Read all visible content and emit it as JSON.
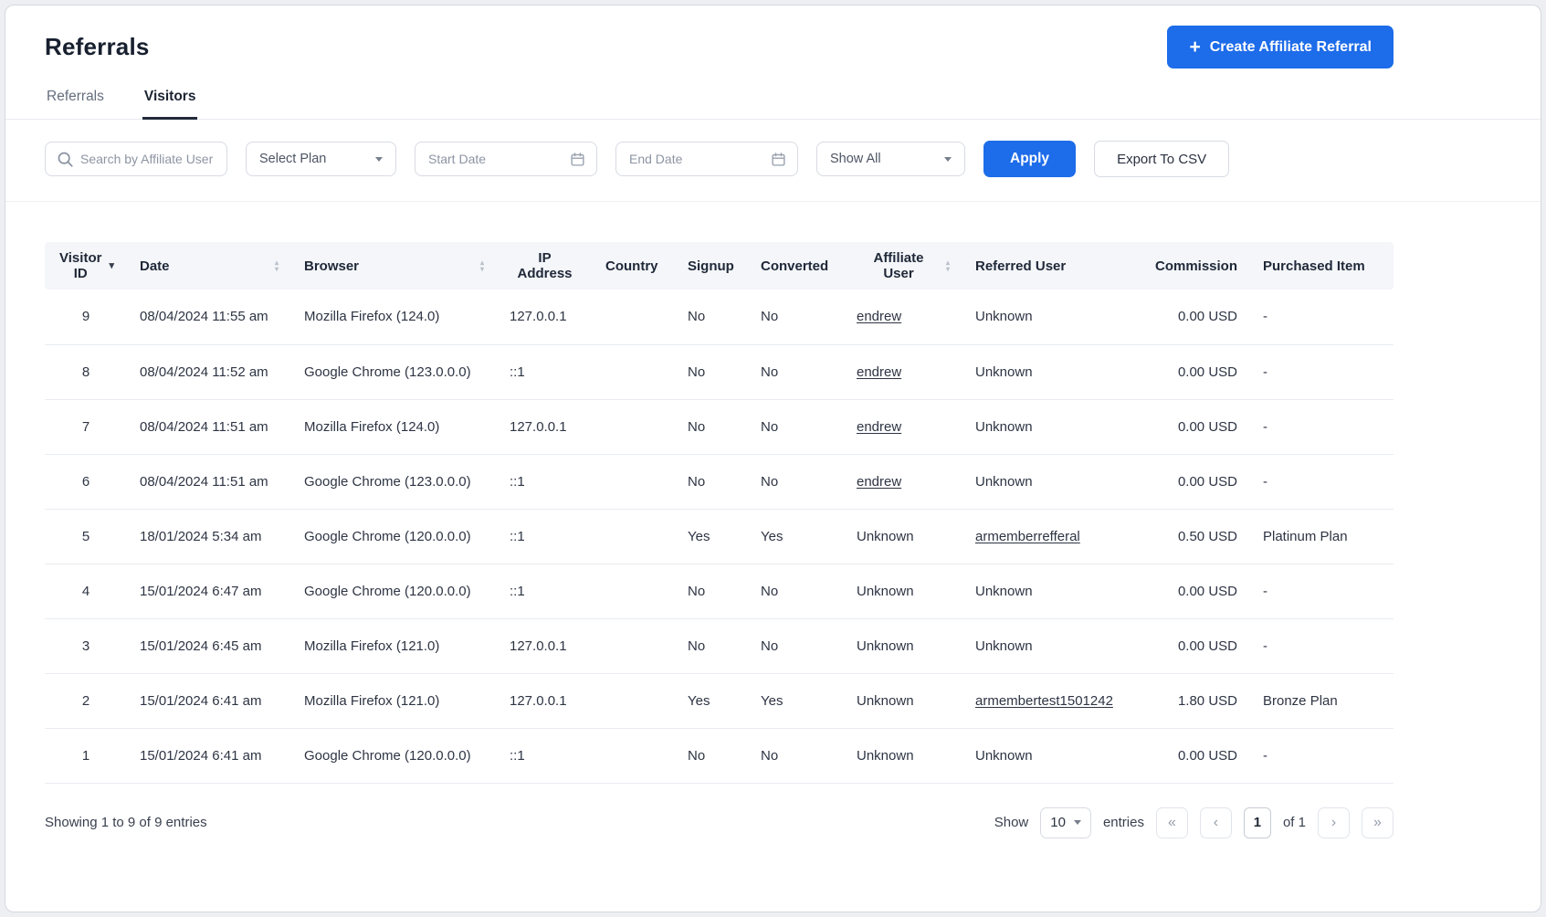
{
  "colors": {
    "accent": "#1d6ce9"
  },
  "page": {
    "title": "Referrals",
    "create_button_label": "Create Affiliate Referral"
  },
  "tabs": [
    {
      "label": "Referrals",
      "active": false
    },
    {
      "label": "Visitors",
      "active": true
    }
  ],
  "filters": {
    "search_placeholder": "Search by Affiliate User",
    "plan_select_value": "Select Plan",
    "start_date_placeholder": "Start Date",
    "end_date_placeholder": "End Date",
    "status_select_value": "Show All",
    "apply_label": "Apply",
    "export_label": "Export To CSV"
  },
  "table": {
    "columns": [
      {
        "key": "id",
        "label": "Visitor ID",
        "sort": "desc",
        "align": "center"
      },
      {
        "key": "date",
        "label": "Date",
        "sort": "both",
        "align": "left"
      },
      {
        "key": "browser",
        "label": "Browser",
        "sort": "both",
        "align": "left"
      },
      {
        "key": "ip",
        "label": "IP Address",
        "sort": null,
        "align": "left"
      },
      {
        "key": "country",
        "label": "Country",
        "sort": null,
        "align": "left"
      },
      {
        "key": "signup",
        "label": "Signup",
        "sort": null,
        "align": "left"
      },
      {
        "key": "converted",
        "label": "Converted",
        "sort": null,
        "align": "left"
      },
      {
        "key": "affiliate",
        "label": "Affiliate User",
        "sort": "both",
        "align": "left"
      },
      {
        "key": "referred",
        "label": "Referred User",
        "sort": null,
        "align": "left"
      },
      {
        "key": "commission",
        "label": "Commission",
        "sort": null,
        "align": "right"
      },
      {
        "key": "item",
        "label": "Purchased Item",
        "sort": null,
        "align": "left"
      }
    ],
    "rows": [
      {
        "id": "9",
        "date": "08/04/2024 11:55 am",
        "browser": "Mozilla Firefox (124.0)",
        "ip": "127.0.0.1",
        "country": "",
        "signup": "No",
        "converted": "No",
        "affiliate": "endrew",
        "affiliate_is_link": true,
        "referred": "Unknown",
        "referred_is_link": false,
        "commission": "0.00 USD",
        "item": "-"
      },
      {
        "id": "8",
        "date": "08/04/2024 11:52 am",
        "browser": "Google Chrome (123.0.0.0)",
        "ip": "::1",
        "country": "",
        "signup": "No",
        "converted": "No",
        "affiliate": "endrew",
        "affiliate_is_link": true,
        "referred": "Unknown",
        "referred_is_link": false,
        "commission": "0.00 USD",
        "item": "-"
      },
      {
        "id": "7",
        "date": "08/04/2024 11:51 am",
        "browser": "Mozilla Firefox (124.0)",
        "ip": "127.0.0.1",
        "country": "",
        "signup": "No",
        "converted": "No",
        "affiliate": "endrew",
        "affiliate_is_link": true,
        "referred": "Unknown",
        "referred_is_link": false,
        "commission": "0.00 USD",
        "item": "-"
      },
      {
        "id": "6",
        "date": "08/04/2024 11:51 am",
        "browser": "Google Chrome (123.0.0.0)",
        "ip": "::1",
        "country": "",
        "signup": "No",
        "converted": "No",
        "affiliate": "endrew",
        "affiliate_is_link": true,
        "referred": "Unknown",
        "referred_is_link": false,
        "commission": "0.00 USD",
        "item": "-"
      },
      {
        "id": "5",
        "date": "18/01/2024 5:34 am",
        "browser": "Google Chrome (120.0.0.0)",
        "ip": "::1",
        "country": "",
        "signup": "Yes",
        "converted": "Yes",
        "affiliate": "Unknown",
        "affiliate_is_link": false,
        "referred": "armemberrefferal",
        "referred_is_link": true,
        "commission": "0.50 USD",
        "item": "Platinum Plan"
      },
      {
        "id": "4",
        "date": "15/01/2024 6:47 am",
        "browser": "Google Chrome (120.0.0.0)",
        "ip": "::1",
        "country": "",
        "signup": "No",
        "converted": "No",
        "affiliate": "Unknown",
        "affiliate_is_link": false,
        "referred": "Unknown",
        "referred_is_link": false,
        "commission": "0.00 USD",
        "item": "-"
      },
      {
        "id": "3",
        "date": "15/01/2024 6:45 am",
        "browser": "Mozilla Firefox (121.0)",
        "ip": "127.0.0.1",
        "country": "",
        "signup": "No",
        "converted": "No",
        "affiliate": "Unknown",
        "affiliate_is_link": false,
        "referred": "Unknown",
        "referred_is_link": false,
        "commission": "0.00 USD",
        "item": "-"
      },
      {
        "id": "2",
        "date": "15/01/2024 6:41 am",
        "browser": "Mozilla Firefox (121.0)",
        "ip": "127.0.0.1",
        "country": "",
        "signup": "Yes",
        "converted": "Yes",
        "affiliate": "Unknown",
        "affiliate_is_link": false,
        "referred": "armembertest1501242",
        "referred_is_link": true,
        "commission": "1.80 USD",
        "item": "Bronze Plan"
      },
      {
        "id": "1",
        "date": "15/01/2024 6:41 am",
        "browser": "Google Chrome (120.0.0.0)",
        "ip": "::1",
        "country": "",
        "signup": "No",
        "converted": "No",
        "affiliate": "Unknown",
        "affiliate_is_link": false,
        "referred": "Unknown",
        "referred_is_link": false,
        "commission": "0.00 USD",
        "item": "-"
      }
    ]
  },
  "footer": {
    "showing_text": "Showing 1 to 9 of 9 entries",
    "show_label": "Show",
    "per_page_value": "10",
    "entries_label": "entries",
    "current_page": "1",
    "of_label": "of 1",
    "first_symbol": "«",
    "prev_symbol": "‹",
    "next_symbol": "›",
    "last_symbol": "»"
  }
}
